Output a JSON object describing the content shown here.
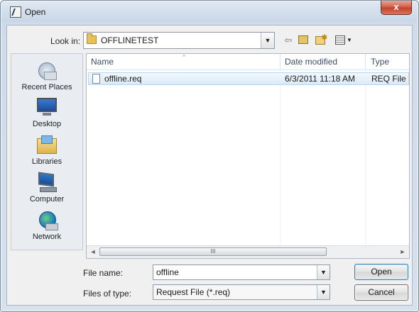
{
  "window": {
    "title": "Open",
    "close_glyph": "x"
  },
  "toolbar": {
    "lookin_label": "Look in:",
    "lookin_value": "OFFLINETEST",
    "icons": [
      "back-icon",
      "up-one-level-icon",
      "new-folder-icon",
      "view-menu-icon"
    ]
  },
  "places": [
    {
      "label": "Recent Places",
      "icon": "recent-places-icon"
    },
    {
      "label": "Desktop",
      "icon": "desktop-icon"
    },
    {
      "label": "Libraries",
      "icon": "libraries-icon"
    },
    {
      "label": "Computer",
      "icon": "computer-icon"
    },
    {
      "label": "Network",
      "icon": "network-icon"
    }
  ],
  "filelist": {
    "columns": [
      "Name",
      "Date modified",
      "Type"
    ],
    "rows": [
      {
        "name": "offline.req",
        "date": "6/3/2011 11:18 AM",
        "type": "REQ File",
        "icon": "document-icon"
      }
    ],
    "scroll_grip": "III"
  },
  "form": {
    "filename_label": "File name:",
    "filename_value": "offline",
    "filetype_label": "Files of type:",
    "filetype_value": "Request File (*.req)",
    "open_label": "Open",
    "cancel_label": "Cancel"
  },
  "colors": {
    "selection": "#dbeaf7",
    "titlebar": "#dfe8f2",
    "close_button": "#c24029"
  }
}
